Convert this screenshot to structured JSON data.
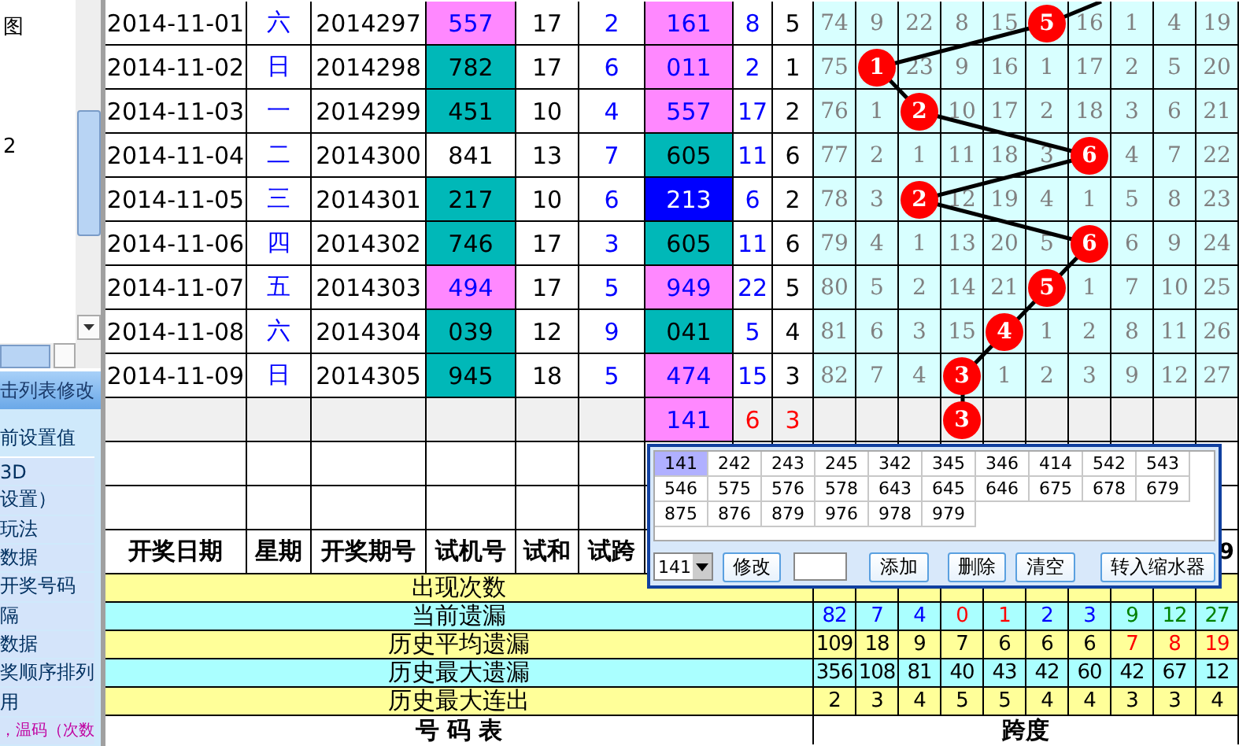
{
  "sidebar": {
    "tree_items": [
      "图",
      "2"
    ],
    "panel_title": "击列表修改",
    "list_items": [
      {
        "text": "前设置值",
        "kind": "heading"
      },
      {
        "text": "3D",
        "kind": "plain"
      },
      {
        "text": "设置）",
        "kind": "plain"
      },
      {
        "text": "玩法",
        "kind": "plain"
      },
      {
        "text": "数据",
        "kind": "plain"
      },
      {
        "text": "开奖号码",
        "kind": "plain"
      },
      {
        "text": "隔",
        "kind": "plain"
      },
      {
        "text": "数据",
        "kind": "plain"
      },
      {
        "text": "奖顺序排列",
        "kind": "plain"
      },
      {
        "text": "用",
        "kind": "plain"
      },
      {
        "text": "，温码（次数",
        "kind": "note"
      }
    ]
  },
  "draws": [
    {
      "kind": "draw",
      "date": "2014-11-01",
      "weekday": "六",
      "issue": "2014297",
      "trial": {
        "text": "557",
        "color": "#ff88ff"
      },
      "sum": "17",
      "span": "2",
      "column_7": {
        "text": "161",
        "color": "#ff88ff"
      },
      "column_8": "8",
      "column_9": "5",
      "chart": [
        {
          "kind": "miss",
          "text": "74"
        },
        {
          "kind": "miss",
          "text": "9"
        },
        {
          "kind": "miss",
          "text": "22"
        },
        {
          "kind": "miss",
          "text": "8"
        },
        {
          "kind": "miss",
          "text": "15"
        },
        {
          "kind": "ball",
          "text": "5"
        },
        {
          "kind": "miss",
          "text": "16"
        },
        {
          "kind": "miss",
          "text": "1"
        },
        {
          "kind": "miss",
          "text": "4"
        },
        {
          "kind": "miss",
          "text": "19"
        }
      ]
    },
    {
      "kind": "draw",
      "date": "2014-11-02",
      "weekday": "日",
      "issue": "2014298",
      "trial": {
        "text": "782",
        "color": "#00b8b8"
      },
      "sum": "17",
      "span": "6",
      "column_7": {
        "text": "011",
        "color": "#ff88ff"
      },
      "column_8": "2",
      "column_9": "1",
      "chart": [
        {
          "kind": "miss",
          "text": "75"
        },
        {
          "kind": "ball",
          "text": "1"
        },
        {
          "kind": "miss",
          "text": "23"
        },
        {
          "kind": "miss",
          "text": "9"
        },
        {
          "kind": "miss",
          "text": "16"
        },
        {
          "kind": "miss",
          "text": "1"
        },
        {
          "kind": "miss",
          "text": "17"
        },
        {
          "kind": "miss",
          "text": "2"
        },
        {
          "kind": "miss",
          "text": "5"
        },
        {
          "kind": "miss",
          "text": "20"
        }
      ]
    },
    {
      "kind": "draw",
      "date": "2014-11-03",
      "weekday": "一",
      "issue": "2014299",
      "trial": {
        "text": "451",
        "color": "#00b8b8"
      },
      "sum": "10",
      "span": "4",
      "column_7": {
        "text": "557",
        "color": "#ff88ff"
      },
      "column_8": "17",
      "column_9": "2",
      "chart": [
        {
          "kind": "miss",
          "text": "76"
        },
        {
          "kind": "miss",
          "text": "1"
        },
        {
          "kind": "ball",
          "text": "2"
        },
        {
          "kind": "miss",
          "text": "10"
        },
        {
          "kind": "miss",
          "text": "17"
        },
        {
          "kind": "miss",
          "text": "2"
        },
        {
          "kind": "miss",
          "text": "18"
        },
        {
          "kind": "miss",
          "text": "3"
        },
        {
          "kind": "miss",
          "text": "6"
        },
        {
          "kind": "miss",
          "text": "21"
        }
      ]
    },
    {
      "kind": "draw",
      "date": "2014-11-04",
      "weekday": "二",
      "issue": "2014300",
      "trial": {
        "text": "841",
        "color": "#ffffff"
      },
      "sum": "13",
      "span": "7",
      "column_7": {
        "text": "605",
        "color": "#00b8b8"
      },
      "column_8": "11",
      "column_9": "6",
      "chart": [
        {
          "kind": "miss",
          "text": "77"
        },
        {
          "kind": "miss",
          "text": "2"
        },
        {
          "kind": "miss",
          "text": "1"
        },
        {
          "kind": "miss",
          "text": "11"
        },
        {
          "kind": "miss",
          "text": "18"
        },
        {
          "kind": "miss",
          "text": "3"
        },
        {
          "kind": "ball",
          "text": "6"
        },
        {
          "kind": "miss",
          "text": "4"
        },
        {
          "kind": "miss",
          "text": "7"
        },
        {
          "kind": "miss",
          "text": "22"
        }
      ]
    },
    {
      "kind": "draw",
      "date": "2014-11-05",
      "weekday": "三",
      "issue": "2014301",
      "trial": {
        "text": "217",
        "color": "#00b8b8"
      },
      "sum": "10",
      "span": "6",
      "column_7": {
        "text": "213",
        "color": "#0000ff"
      },
      "column_8": "6",
      "column_9": "2",
      "chart": [
        {
          "kind": "miss",
          "text": "78"
        },
        {
          "kind": "miss",
          "text": "3"
        },
        {
          "kind": "ball",
          "text": "2"
        },
        {
          "kind": "miss",
          "text": "12"
        },
        {
          "kind": "miss",
          "text": "19"
        },
        {
          "kind": "miss",
          "text": "4"
        },
        {
          "kind": "miss",
          "text": "1"
        },
        {
          "kind": "miss",
          "text": "5"
        },
        {
          "kind": "miss",
          "text": "8"
        },
        {
          "kind": "miss",
          "text": "23"
        }
      ]
    },
    {
      "kind": "draw",
      "date": "2014-11-06",
      "weekday": "四",
      "issue": "2014302",
      "trial": {
        "text": "746",
        "color": "#00b8b8"
      },
      "sum": "17",
      "span": "3",
      "column_7": {
        "text": "605",
        "color": "#00b8b8"
      },
      "column_8": "11",
      "column_9": "6",
      "chart": [
        {
          "kind": "miss",
          "text": "79"
        },
        {
          "kind": "miss",
          "text": "4"
        },
        {
          "kind": "miss",
          "text": "1"
        },
        {
          "kind": "miss",
          "text": "13"
        },
        {
          "kind": "miss",
          "text": "20"
        },
        {
          "kind": "miss",
          "text": "5"
        },
        {
          "kind": "ball",
          "text": "6"
        },
        {
          "kind": "miss",
          "text": "6"
        },
        {
          "kind": "miss",
          "text": "9"
        },
        {
          "kind": "miss",
          "text": "24"
        }
      ]
    },
    {
      "kind": "draw",
      "date": "2014-11-07",
      "weekday": "五",
      "issue": "2014303",
      "trial": {
        "text": "494",
        "color": "#ff88ff"
      },
      "sum": "17",
      "span": "5",
      "column_7": {
        "text": "949",
        "color": "#ff88ff"
      },
      "column_8": "22",
      "column_9": "5",
      "chart": [
        {
          "kind": "miss",
          "text": "80"
        },
        {
          "kind": "miss",
          "text": "5"
        },
        {
          "kind": "miss",
          "text": "2"
        },
        {
          "kind": "miss",
          "text": "14"
        },
        {
          "kind": "miss",
          "text": "21"
        },
        {
          "kind": "ball",
          "text": "5"
        },
        {
          "kind": "miss",
          "text": "1"
        },
        {
          "kind": "miss",
          "text": "7"
        },
        {
          "kind": "miss",
          "text": "10"
        },
        {
          "kind": "miss",
          "text": "25"
        }
      ]
    },
    {
      "kind": "draw",
      "date": "2014-11-08",
      "weekday": "六",
      "issue": "2014304",
      "trial": {
        "text": "039",
        "color": "#00b8b8"
      },
      "sum": "12",
      "span": "9",
      "column_7": {
        "text": "041",
        "color": "#00b8b8"
      },
      "column_8": "5",
      "column_9": "4",
      "chart": [
        {
          "kind": "miss",
          "text": "81"
        },
        {
          "kind": "miss",
          "text": "6"
        },
        {
          "kind": "miss",
          "text": "3"
        },
        {
          "kind": "miss",
          "text": "15"
        },
        {
          "kind": "ball",
          "text": "4"
        },
        {
          "kind": "miss",
          "text": "1"
        },
        {
          "kind": "miss",
          "text": "2"
        },
        {
          "kind": "miss",
          "text": "8"
        },
        {
          "kind": "miss",
          "text": "11"
        },
        {
          "kind": "miss",
          "text": "26"
        }
      ]
    },
    {
      "kind": "draw",
      "date": "2014-11-09",
      "weekday": "日",
      "issue": "2014305",
      "trial": {
        "text": "945",
        "color": "#00b8b8"
      },
      "sum": "18",
      "span": "5",
      "column_7": {
        "text": "474",
        "color": "#ff88ff"
      },
      "column_8": "15",
      "column_9": "3",
      "chart": [
        {
          "kind": "miss",
          "text": "82"
        },
        {
          "kind": "miss",
          "text": "7"
        },
        {
          "kind": "miss",
          "text": "4"
        },
        {
          "kind": "ball",
          "text": "3"
        },
        {
          "kind": "miss",
          "text": "1"
        },
        {
          "kind": "miss",
          "text": "2"
        },
        {
          "kind": "miss",
          "text": "3"
        },
        {
          "kind": "miss",
          "text": "9"
        },
        {
          "kind": "miss",
          "text": "12"
        },
        {
          "kind": "miss",
          "text": "27"
        }
      ]
    },
    {
      "kind": "forecast",
      "column_7": {
        "text": "141",
        "color": "#ff88ff"
      },
      "column_8": "6",
      "column_9": "3",
      "chart": [
        {
          "kind": "blank"
        },
        {
          "kind": "blank"
        },
        {
          "kind": "blank"
        },
        {
          "kind": "ball",
          "text": "3"
        },
        {
          "kind": "blank"
        },
        {
          "kind": "blank"
        },
        {
          "kind": "blank"
        },
        {
          "kind": "blank"
        },
        {
          "kind": "blank"
        },
        {
          "kind": "blank"
        }
      ]
    }
  ],
  "header": {
    "columns": [
      "开奖日期",
      "星期",
      "开奖期号",
      "试机号",
      "试和",
      "试跨"
    ],
    "chart_column_10": "9"
  },
  "stats": [
    {
      "label": "出现次数",
      "color": "#ffff99"
    },
    {
      "label": "当前遗漏",
      "color": "#aaffff",
      "values": [
        {
          "text": "82",
          "color": "#0000ff"
        },
        {
          "text": "7",
          "color": "#0000ff"
        },
        {
          "text": "4",
          "color": "#0000ff"
        },
        {
          "text": "0",
          "color": "#ff0000"
        },
        {
          "text": "1",
          "color": "#ff0000"
        },
        {
          "text": "2",
          "color": "#0000ff"
        },
        {
          "text": "3",
          "color": "#0000ff"
        },
        {
          "text": "9",
          "color": "#008000"
        },
        {
          "text": "12",
          "color": "#008000"
        },
        {
          "text": "27",
          "color": "#008000"
        }
      ]
    },
    {
      "label": "历史平均遗漏",
      "color": "#ffff99",
      "values": [
        {
          "text": "109",
          "color": "#000000"
        },
        {
          "text": "18",
          "color": "#000000"
        },
        {
          "text": "9",
          "color": "#000000"
        },
        {
          "text": "7",
          "color": "#000000"
        },
        {
          "text": "6",
          "color": "#000000"
        },
        {
          "text": "6",
          "color": "#000000"
        },
        {
          "text": "6",
          "color": "#000000"
        },
        {
          "text": "7",
          "color": "#ff0000"
        },
        {
          "text": "8",
          "color": "#ff0000"
        },
        {
          "text": "19",
          "color": "#ff0000"
        }
      ]
    },
    {
      "label": "历史最大遗漏",
      "color": "#aaffff",
      "values": [
        "356",
        "108",
        "81",
        "40",
        "43",
        "42",
        "60",
        "42",
        "67",
        "12"
      ]
    },
    {
      "label": "历史最大连出",
      "color": "#ffff99",
      "values": [
        "2",
        "3",
        "4",
        "5",
        "5",
        "4",
        "4",
        "3",
        "3",
        "4"
      ]
    }
  ],
  "footer": {
    "left": "号 码 表",
    "right": "跨度"
  },
  "popup": {
    "numbers": [
      {
        "text": "141",
        "selected": true
      },
      {
        "text": "242",
        "selected": false
      },
      {
        "text": "243",
        "selected": false
      },
      {
        "text": "245",
        "selected": false
      },
      {
        "text": "342",
        "selected": false
      },
      {
        "text": "345",
        "selected": false
      },
      {
        "text": "346",
        "selected": false
      },
      {
        "text": "414",
        "selected": false
      },
      {
        "text": "542",
        "selected": false
      },
      {
        "text": "543",
        "selected": false
      },
      {
        "text": "546",
        "selected": false
      },
      {
        "text": "575",
        "selected": false
      },
      {
        "text": "576",
        "selected": false
      },
      {
        "text": "578",
        "selected": false
      },
      {
        "text": "643",
        "selected": false
      },
      {
        "text": "645",
        "selected": false
      },
      {
        "text": "646",
        "selected": false
      },
      {
        "text": "675",
        "selected": false
      },
      {
        "text": "678",
        "selected": false
      },
      {
        "text": "679",
        "selected": false
      },
      {
        "text": "875",
        "selected": false
      },
      {
        "text": "876",
        "selected": false
      },
      {
        "text": "879",
        "selected": false
      },
      {
        "text": "976",
        "selected": false
      },
      {
        "text": "978",
        "selected": false
      },
      {
        "text": "979",
        "selected": false
      }
    ],
    "select_value": "141",
    "buttons": [
      "修改",
      "添加",
      "删除",
      "清空",
      "转入缩水器"
    ]
  }
}
